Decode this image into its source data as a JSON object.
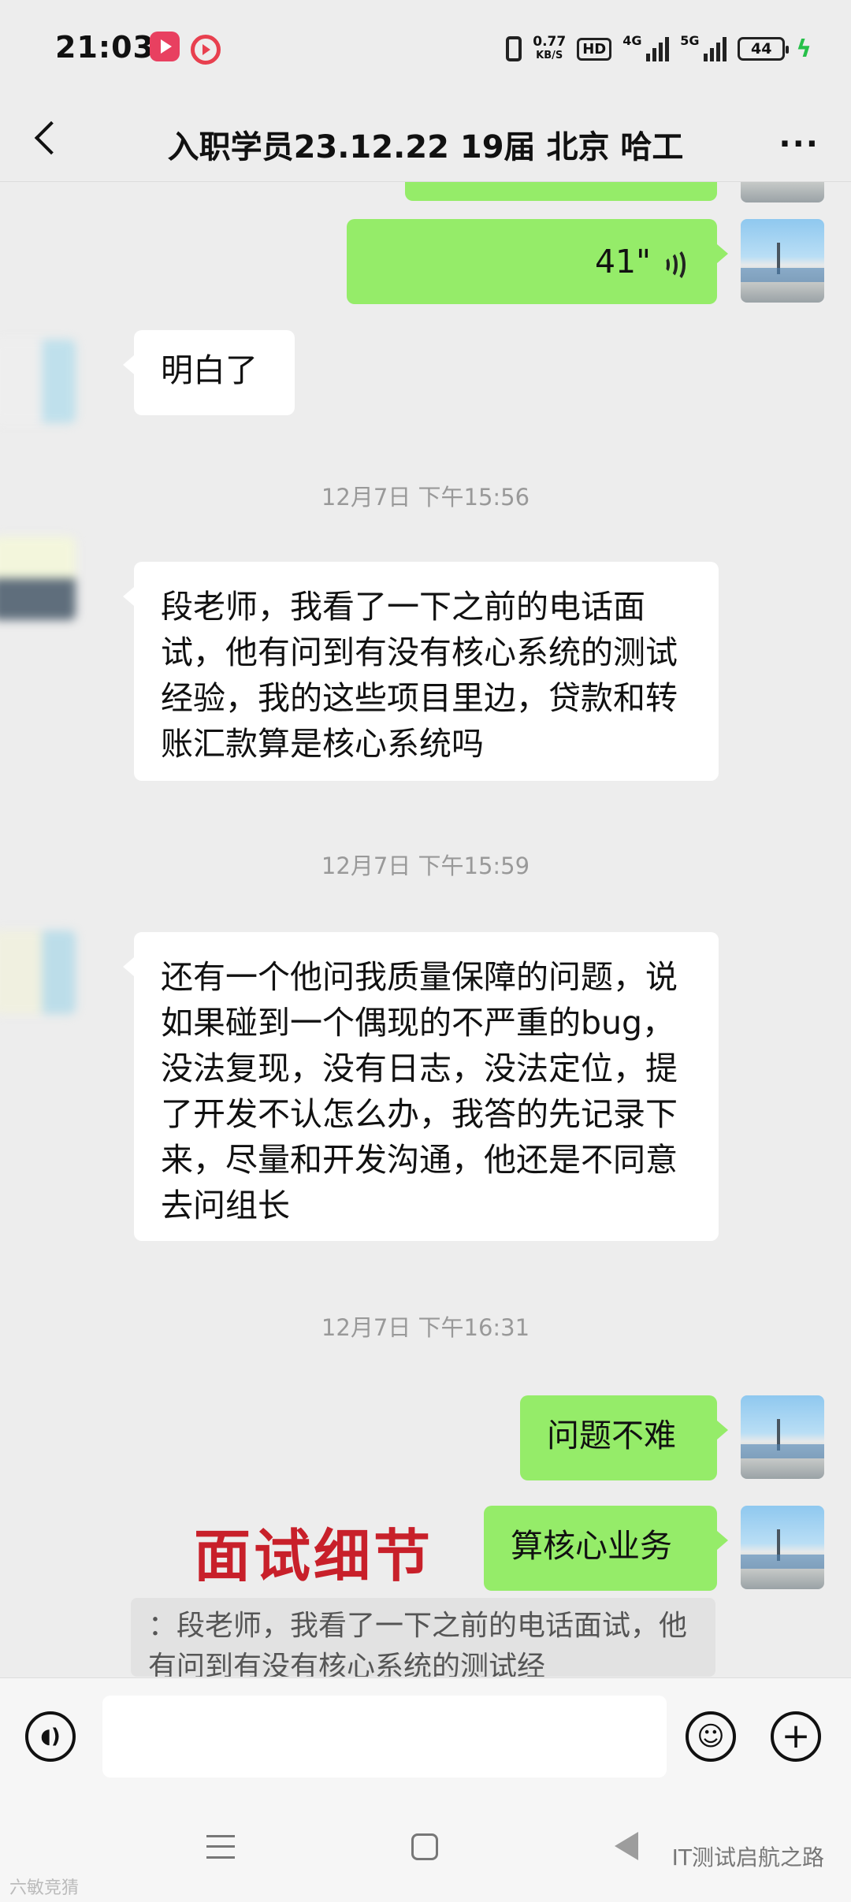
{
  "status_bar": {
    "time": "21:03",
    "net_speed_value": "0.77",
    "net_speed_unit": "KB/S",
    "hd_label": "HD",
    "signal_1_label": "4G",
    "signal_2_label": "5G",
    "battery": "44"
  },
  "header": {
    "title": "入职学员23.12.22 19届 北京 哈工",
    "more": "···"
  },
  "messages": {
    "voice_duration": "41\"",
    "msg_understood": "明白了",
    "ts_1": "12月7日 下午15:56",
    "msg_interview_1": "段老师，我看了一下之前的电话面试，他有问到有没有核心系统的测试经验，我的这些项目里边，贷款和转账汇款算是核心系统吗",
    "ts_2": "12月7日 下午15:59",
    "msg_interview_2": "还有一个他问我质量保障的问题，说如果碰到一个偶现的不严重的bug，没法复现，没有日志，没法定位，提了开发不认怎么办，我答的先记录下来，尽量和开发沟通，他还是不同意去问组长",
    "ts_3": "12月7日 下午16:31",
    "reply_1": "问题不难",
    "reply_2": "算核心业务",
    "quote": "：段老师，我看了一下之前的电话面试，他有问到有没有核心系统的测试经"
  },
  "overlay": {
    "watermark": "面试细节",
    "brand": "IT测试启航之路",
    "bottom_left_mark": "六敏竞猜"
  },
  "input": {
    "placeholder": ""
  },
  "colors": {
    "background": "#ededed",
    "sent_bubble": "#95ec69",
    "received_bubble": "#ffffff",
    "watermark": "#c8202a"
  }
}
